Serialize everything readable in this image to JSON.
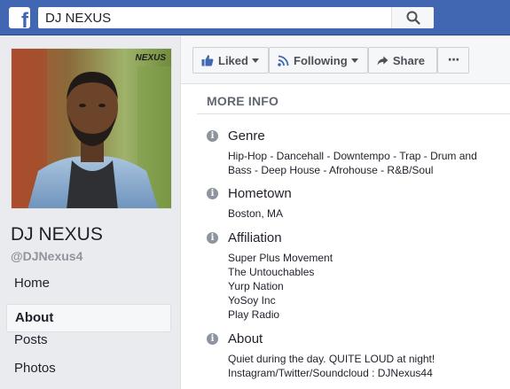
{
  "header": {
    "logo_letter": "f",
    "search_value": "DJ NEXUS",
    "brand_color": "#4267b2"
  },
  "profile": {
    "watermark": "NEXUS",
    "name": "DJ NEXUS",
    "handle": "@DJNexus4"
  },
  "nav": {
    "items": [
      {
        "label": "Home"
      },
      {
        "label": "About"
      },
      {
        "label": "Posts"
      },
      {
        "label": "Photos"
      }
    ],
    "active": "About"
  },
  "actions": {
    "liked": "Liked",
    "following": "Following",
    "share": "Share",
    "more": "···"
  },
  "more_info": {
    "heading": "MORE INFO",
    "genre": {
      "title": "Genre",
      "lines": [
        "Hip-Hop - Dancehall - Downtempo - Trap - Drum and",
        "Bass - Deep House - Afrohouse - R&B/Soul"
      ]
    },
    "hometown": {
      "title": "Hometown",
      "lines": [
        "Boston, MA"
      ]
    },
    "affiliation": {
      "title": "Affiliation",
      "lines": [
        "Super Plus Movement",
        "The Untouchables",
        "Yurp Nation",
        "YoSoy Inc",
        "Play Radio"
      ]
    },
    "about": {
      "title": "About",
      "lines": [
        "Quiet during the day. QUITE LOUD at night!",
        "Instagram/Twitter/Soundcloud : DJNexus44"
      ]
    }
  }
}
